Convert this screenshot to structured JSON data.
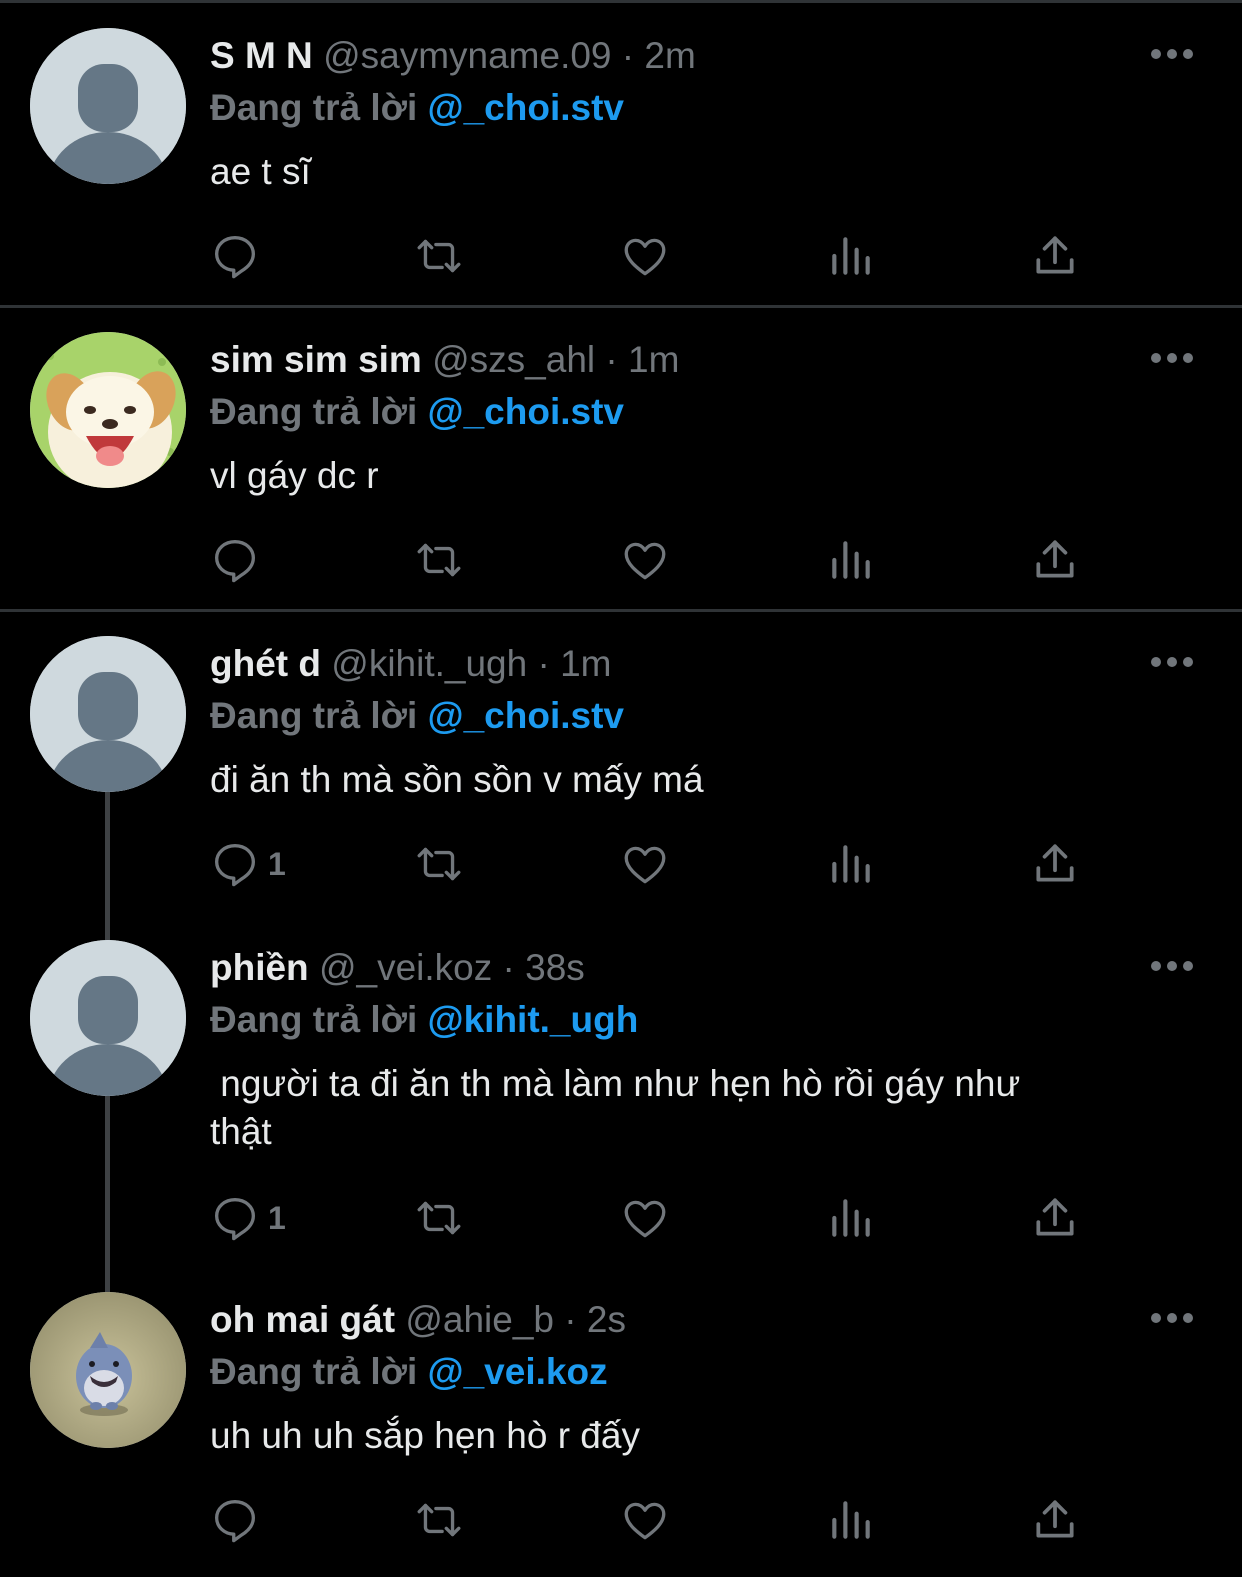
{
  "colors": {
    "background": "#000000",
    "name_text": "#e7e9ea",
    "secondary_text": "#71767b",
    "mention": "#1d9bf0",
    "divider": "#2f3336"
  },
  "tweets": [
    {
      "name": "S M N",
      "handle": "@saymyname.09",
      "time": "2m",
      "replying_prefix": "Đang trả lời",
      "replying_to": "@_choi.stv",
      "text": "ae t sĩ",
      "reply_count": "",
      "avatar": "default-avatar"
    },
    {
      "name": "sim sim sim",
      "handle": "@szs_ahl",
      "time": "1m",
      "replying_prefix": "Đang trả lời",
      "replying_to": "@_choi.stv",
      "text": "vl gáy dc r",
      "reply_count": "",
      "avatar": "cartoon-dog-avatar"
    },
    {
      "name": "ghét d",
      "handle": "@kihit._ugh",
      "time": "1m",
      "replying_prefix": "Đang trả lời",
      "replying_to": "@_choi.stv",
      "text": "đi ăn th mà sồn sồn v mấy má",
      "reply_count": "1",
      "avatar": "default-avatar"
    },
    {
      "name": "phiền",
      "handle": "@_vei.koz",
      "time": "38s",
      "replying_prefix": "Đang trả lời",
      "replying_to": "@kihit._ugh",
      "text": " người ta đi ăn th mà làm như hẹn hò rồi gáy như\nthật",
      "reply_count": "1",
      "avatar": "default-avatar"
    },
    {
      "name": "oh mai gát",
      "handle": "@ahie_b",
      "time": "2s",
      "replying_prefix": "Đang trả lời",
      "replying_to": "@_vei.koz",
      "text": "uh uh uh sắp hẹn hò r đấy",
      "reply_count": "",
      "avatar": "shark-avatar"
    }
  ]
}
